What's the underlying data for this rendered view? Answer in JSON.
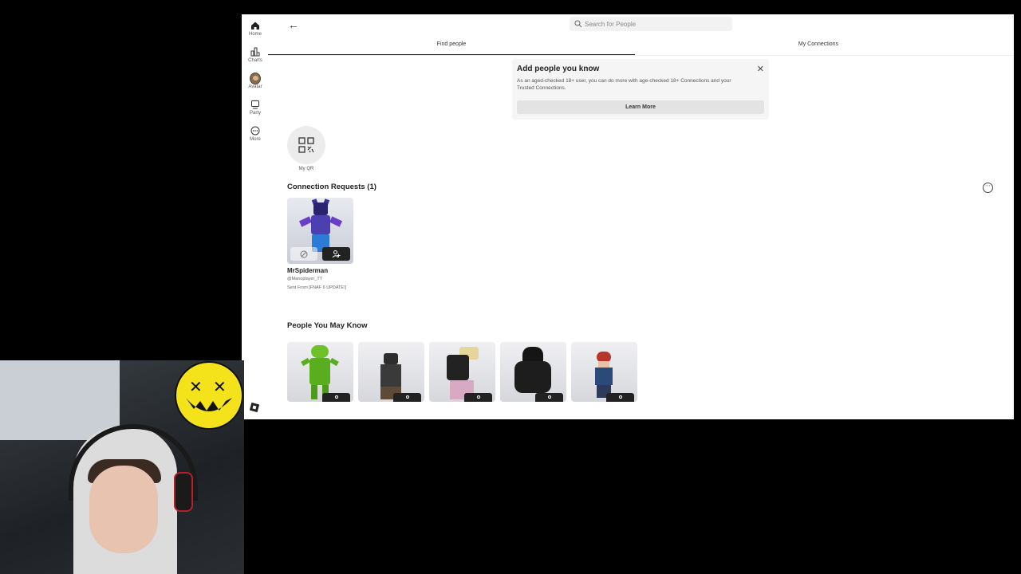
{
  "rail": {
    "items": [
      {
        "label": "Home",
        "icon": "home-icon"
      },
      {
        "label": "Charts",
        "icon": "charts-icon"
      },
      {
        "label": "Avatar",
        "icon": "avatar-icon"
      },
      {
        "label": "Party",
        "icon": "party-icon"
      },
      {
        "label": "More",
        "icon": "more-icon"
      }
    ]
  },
  "header": {
    "search_placeholder": "Search for People"
  },
  "tabs": {
    "find": "Find people",
    "connections": "My Connections"
  },
  "add_card": {
    "title": "Add people you know",
    "description": "As an aged-checked 18+ user, you can do more with age-checked 18+ Connections and your Trusted Connections.",
    "button": "Learn More"
  },
  "qr": {
    "label": "My QR"
  },
  "connection_requests": {
    "title": "Connection Requests (1)",
    "items": [
      {
        "name": "MrSpiderman",
        "handle": "@Manoplayer_TT",
        "sent_from": "Sent From [FNAF 6 UPDATE!]"
      }
    ]
  },
  "people_you_may_know": {
    "title": "People You May Know"
  },
  "colors": {
    "accent": "#222222",
    "card_bg": "#f5f5f5",
    "smiley": "#f4e31a"
  }
}
